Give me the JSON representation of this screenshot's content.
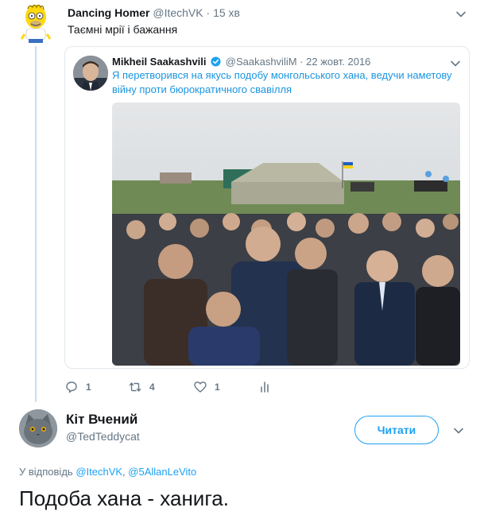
{
  "tweet1": {
    "name": "Dancing Homer",
    "handle": "@ItechVK",
    "dot": "·",
    "time": "15 хв",
    "text": "Таємні мрії і бажання",
    "avatar_icon": "homer-avatar-icon",
    "menu_icon": "chevron-down-icon"
  },
  "quote": {
    "name": "Mikheil Saakashvili",
    "handle": "@SaakashviliM",
    "dot": "·",
    "date": "22 жовт. 2016",
    "text": "Я перетворився на якусь подобу монгольського хана, ведучи наметову війну проти бюрократичного свавілля",
    "verified_icon": "verified-badge-icon"
  },
  "actions": {
    "reply_count": "1",
    "retweet_count": "4",
    "like_count": "1"
  },
  "tweet2": {
    "name": "Кіт Вчений",
    "handle": "@TedTeddycat",
    "follow_label": "Читати",
    "reply_prefix": "У відповідь",
    "mention1": "@ItechVK",
    "separator": ",",
    "mention2": "@5AllanLeVito",
    "text": "Подоба хана - ханига."
  },
  "colors": {
    "accent": "#1da1f2",
    "link": "#1b95e0",
    "muted": "#657786",
    "thread_line": "#c4e1f4",
    "border": "#e1e8ed"
  }
}
